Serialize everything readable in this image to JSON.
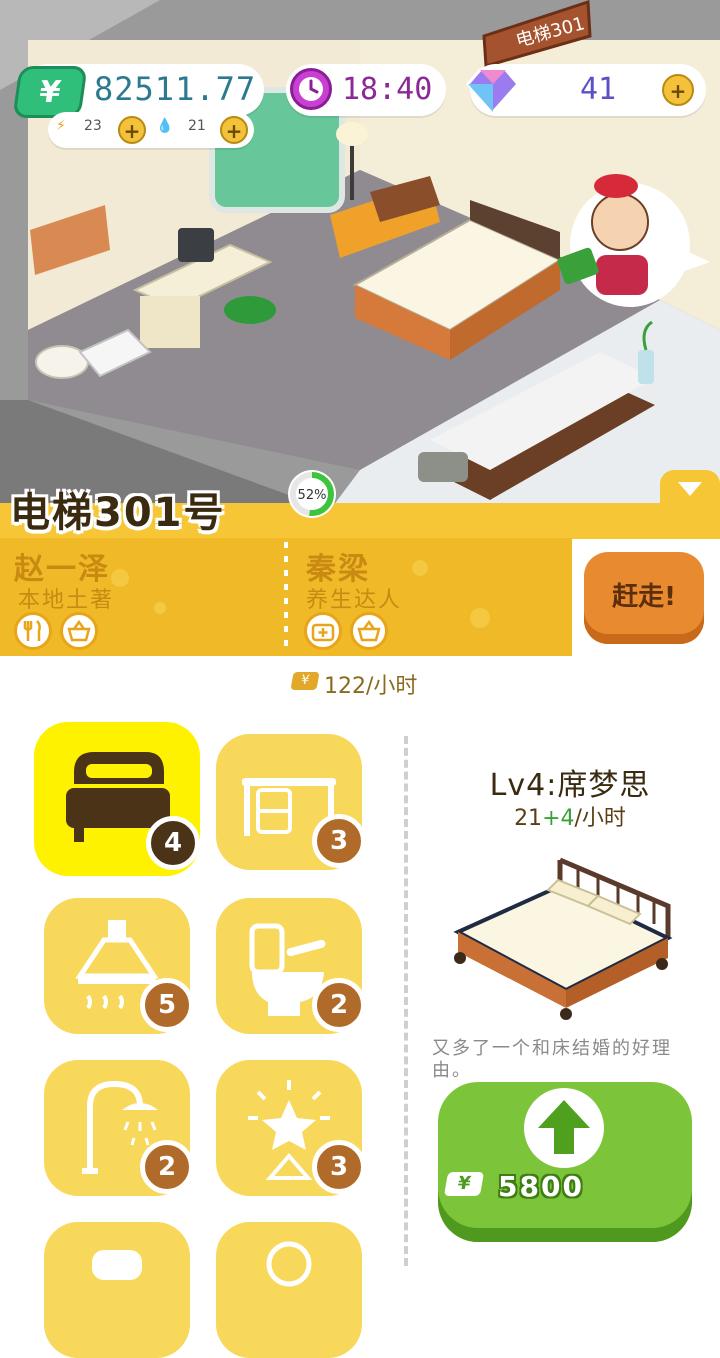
{
  "hud": {
    "money": "82511.77",
    "money_symbol": "¥",
    "energy": "23",
    "water": "21",
    "time": "18:40",
    "gems": "41"
  },
  "room": {
    "title": "电梯301号",
    "sign": "电梯301",
    "progress_label": "52%",
    "progress": 0.52
  },
  "tenants": [
    {
      "name": "赵一泽",
      "desc": "本地土著",
      "traits": [
        "fork-knife-icon",
        "basket-icon"
      ]
    },
    {
      "name": "秦梁",
      "desc": "养生达人",
      "traits": [
        "medkit-icon",
        "basket-icon"
      ]
    }
  ],
  "evict_label": "赶走!",
  "income": {
    "symbol": "¥",
    "text": "122/小时"
  },
  "furniture": [
    {
      "name": "bed",
      "icon": "bed-icon",
      "level": "4",
      "selected": true
    },
    {
      "name": "desk",
      "icon": "desk-icon",
      "level": "3",
      "selected": false
    },
    {
      "name": "range-hood",
      "icon": "range-hood-icon",
      "level": "5",
      "selected": false
    },
    {
      "name": "toilet",
      "icon": "toilet-icon",
      "level": "2",
      "selected": false
    },
    {
      "name": "shower",
      "icon": "shower-icon",
      "level": "2",
      "selected": false
    },
    {
      "name": "decor",
      "icon": "star-lamp-icon",
      "level": "3",
      "selected": false
    }
  ],
  "detail": {
    "title": "Lv4:席梦思",
    "rate_base": "21",
    "rate_bonus": "+4",
    "rate_unit": "/小时",
    "description": "又多了一个和床结婚的好理由。",
    "upgrade_symbol": "¥",
    "upgrade_cost": "5800"
  },
  "colors": {
    "accent_yellow": "#f6c637",
    "upgrade_green": "#7cc43a",
    "money_green": "#2fbf7a"
  }
}
